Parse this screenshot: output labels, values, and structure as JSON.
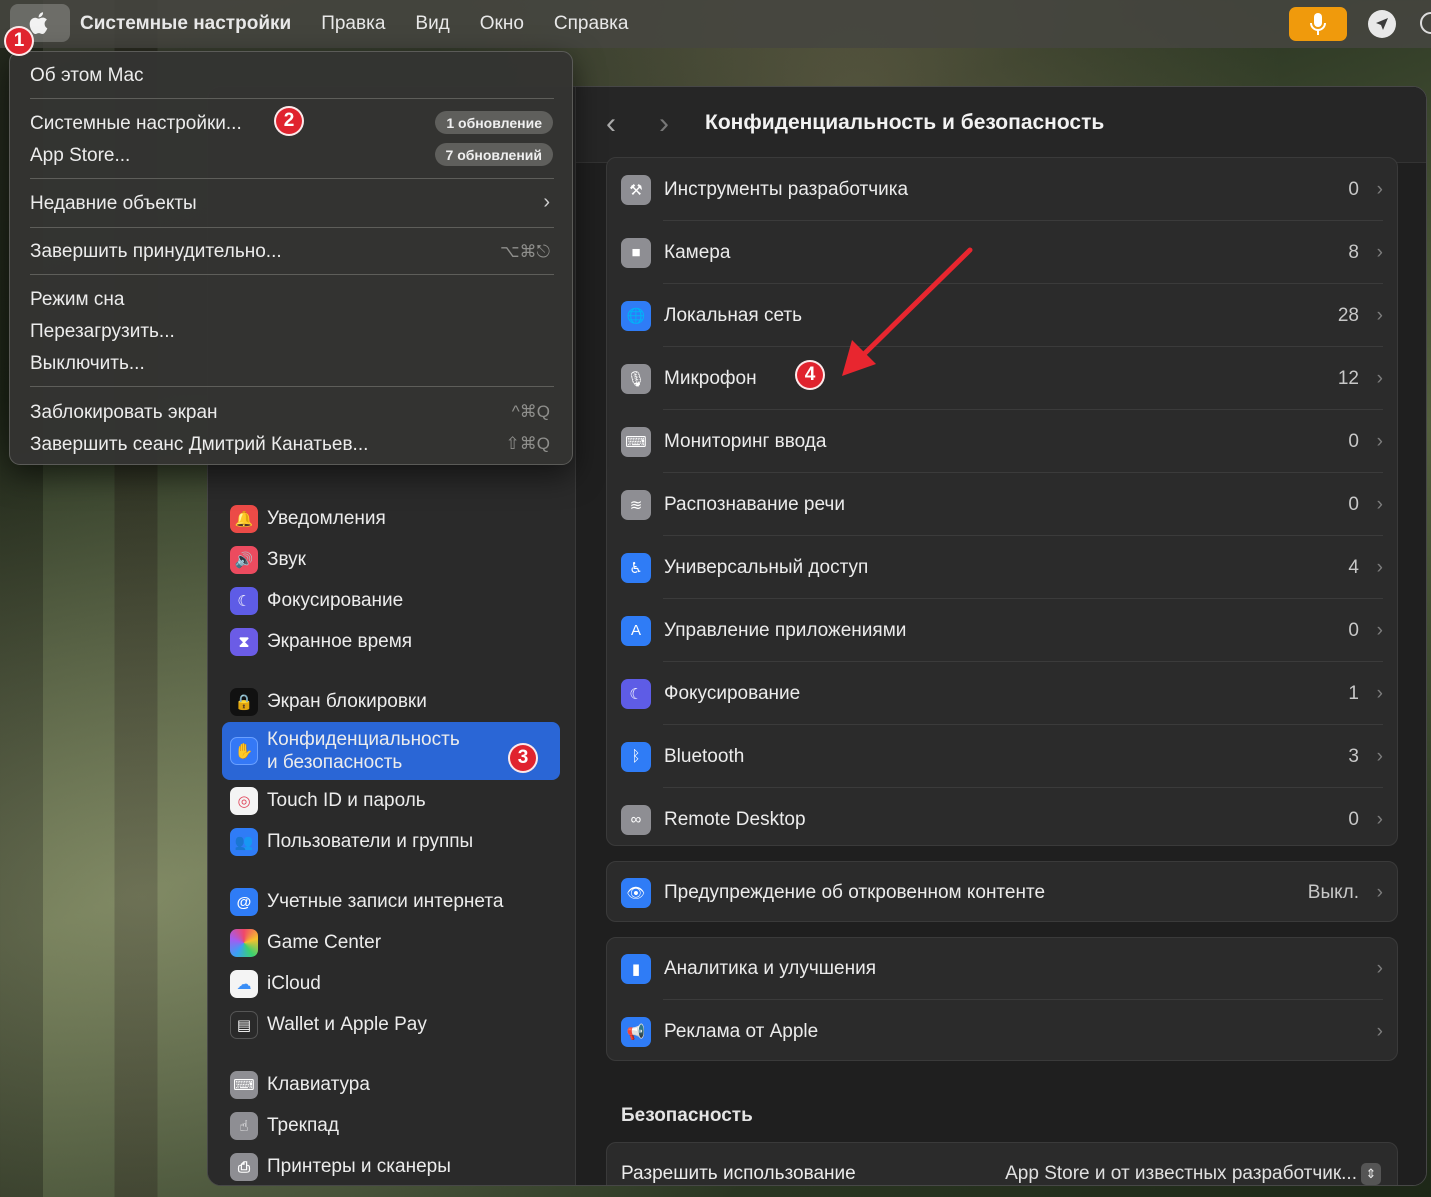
{
  "menubar": {
    "app_name": "Системные настройки",
    "items": [
      "Правка",
      "Вид",
      "Окно",
      "Справка"
    ]
  },
  "apple_menu": {
    "about": "Об этом Mac",
    "system_settings": "Системные настройки...",
    "system_settings_badge": "1 обновление",
    "app_store": "App Store...",
    "app_store_badge": "7 обновлений",
    "recent": "Недавние объекты",
    "force_quit": "Завершить принудительно...",
    "force_quit_shortcut": "⌥⌘⎋",
    "sleep": "Режим сна",
    "restart": "Перезагрузить...",
    "shutdown": "Выключить...",
    "lock": "Заблокировать экран",
    "lock_shortcut": "^⌘Q",
    "logout": "Завершить сеанс Дмитрий Канатьев...",
    "logout_shortcut": "⇧⌘Q"
  },
  "badges": [
    "1",
    "2",
    "3",
    "4"
  ],
  "sidebar": {
    "items": [
      {
        "label": "Уведомления",
        "icon": "bell-icon",
        "color": "#ec4b47"
      },
      {
        "label": "Звук",
        "icon": "speaker-icon",
        "color": "#ec4b5f"
      },
      {
        "label": "Фокусирование",
        "icon": "moon-icon",
        "color": "#5e5ce6"
      },
      {
        "label": "Экранное время",
        "icon": "hourglass-icon",
        "color": "#6b5ce6"
      },
      {
        "label": "Экран блокировки",
        "icon": "lock-icon",
        "color": "#111111"
      },
      {
        "label": "Конфиденциальность и безопасность",
        "icon": "hand-icon",
        "color": "#3478f6"
      },
      {
        "label": "Touch ID и пароль",
        "icon": "fingerprint-icon",
        "color": "#f4f4f4"
      },
      {
        "label": "Пользователи и группы",
        "icon": "users-icon",
        "color": "#2f7cf6"
      },
      {
        "label": "Учетные записи интернета",
        "icon": "at-icon",
        "color": "#2f7cf6"
      },
      {
        "label": "Game Center",
        "icon": "gamecenter-icon",
        "color": "#f4f4f4"
      },
      {
        "label": "iCloud",
        "icon": "cloud-icon",
        "color": "#f4f4f4"
      },
      {
        "label": "Wallet и Apple Pay",
        "icon": "wallet-icon",
        "color": "#2a2a2a"
      },
      {
        "label": "Клавиатура",
        "icon": "keyboard-icon",
        "color": "#8e8e93"
      },
      {
        "label": "Трекпад",
        "icon": "trackpad-icon",
        "color": "#8e8e93"
      },
      {
        "label": "Принтеры и сканеры",
        "icon": "printer-icon",
        "color": "#8e8e93"
      }
    ],
    "selected_line1": "Конфиденциальность",
    "selected_line2": "и безопасность"
  },
  "main": {
    "title": "Конфиденциальность и безопасность",
    "privacy_rows": [
      {
        "label": "Инструменты разработчика",
        "value": "0",
        "icon": "hammer-icon",
        "color": "#8e8e93"
      },
      {
        "label": "Камера",
        "value": "8",
        "icon": "camera-icon",
        "color": "#8e8e93"
      },
      {
        "label": "Локальная сеть",
        "value": "28",
        "icon": "globe-icon",
        "color": "#2f7cf6"
      },
      {
        "label": "Микрофон",
        "value": "12",
        "icon": "microphone-icon",
        "color": "#8e8e93"
      },
      {
        "label": "Мониторинг ввода",
        "value": "0",
        "icon": "keyboard-icon",
        "color": "#8e8e93"
      },
      {
        "label": "Распознавание речи",
        "value": "0",
        "icon": "waveform-icon",
        "color": "#8e8e93"
      },
      {
        "label": "Универсальный доступ",
        "value": "4",
        "icon": "accessibility-icon",
        "color": "#2f7cf6"
      },
      {
        "label": "Управление приложениями",
        "value": "0",
        "icon": "appstore-icon",
        "color": "#2f7cf6"
      },
      {
        "label": "Фокусирование",
        "value": "1",
        "icon": "moon-icon",
        "color": "#5e5ce6"
      },
      {
        "label": "Bluetooth",
        "value": "3",
        "icon": "bluetooth-icon",
        "color": "#2f7cf6"
      },
      {
        "label": "Remote Desktop",
        "value": "0",
        "icon": "binoculars-icon",
        "color": "#8e8e93"
      }
    ],
    "sensitive": {
      "label": "Предупреждение об откровенном контенте",
      "value": "Выкл.",
      "icon": "eye-icon",
      "color": "#2f7cf6"
    },
    "analytics_rows": [
      {
        "label": "Аналитика и улучшения",
        "icon": "chart-icon",
        "color": "#2f7cf6"
      },
      {
        "label": "Реклама от Apple",
        "icon": "megaphone-icon",
        "color": "#2f7cf6"
      }
    ],
    "security_title": "Безопасность",
    "allow_label": "Разрешить использование",
    "allow_value": "App Store и от известных разработчик..."
  }
}
